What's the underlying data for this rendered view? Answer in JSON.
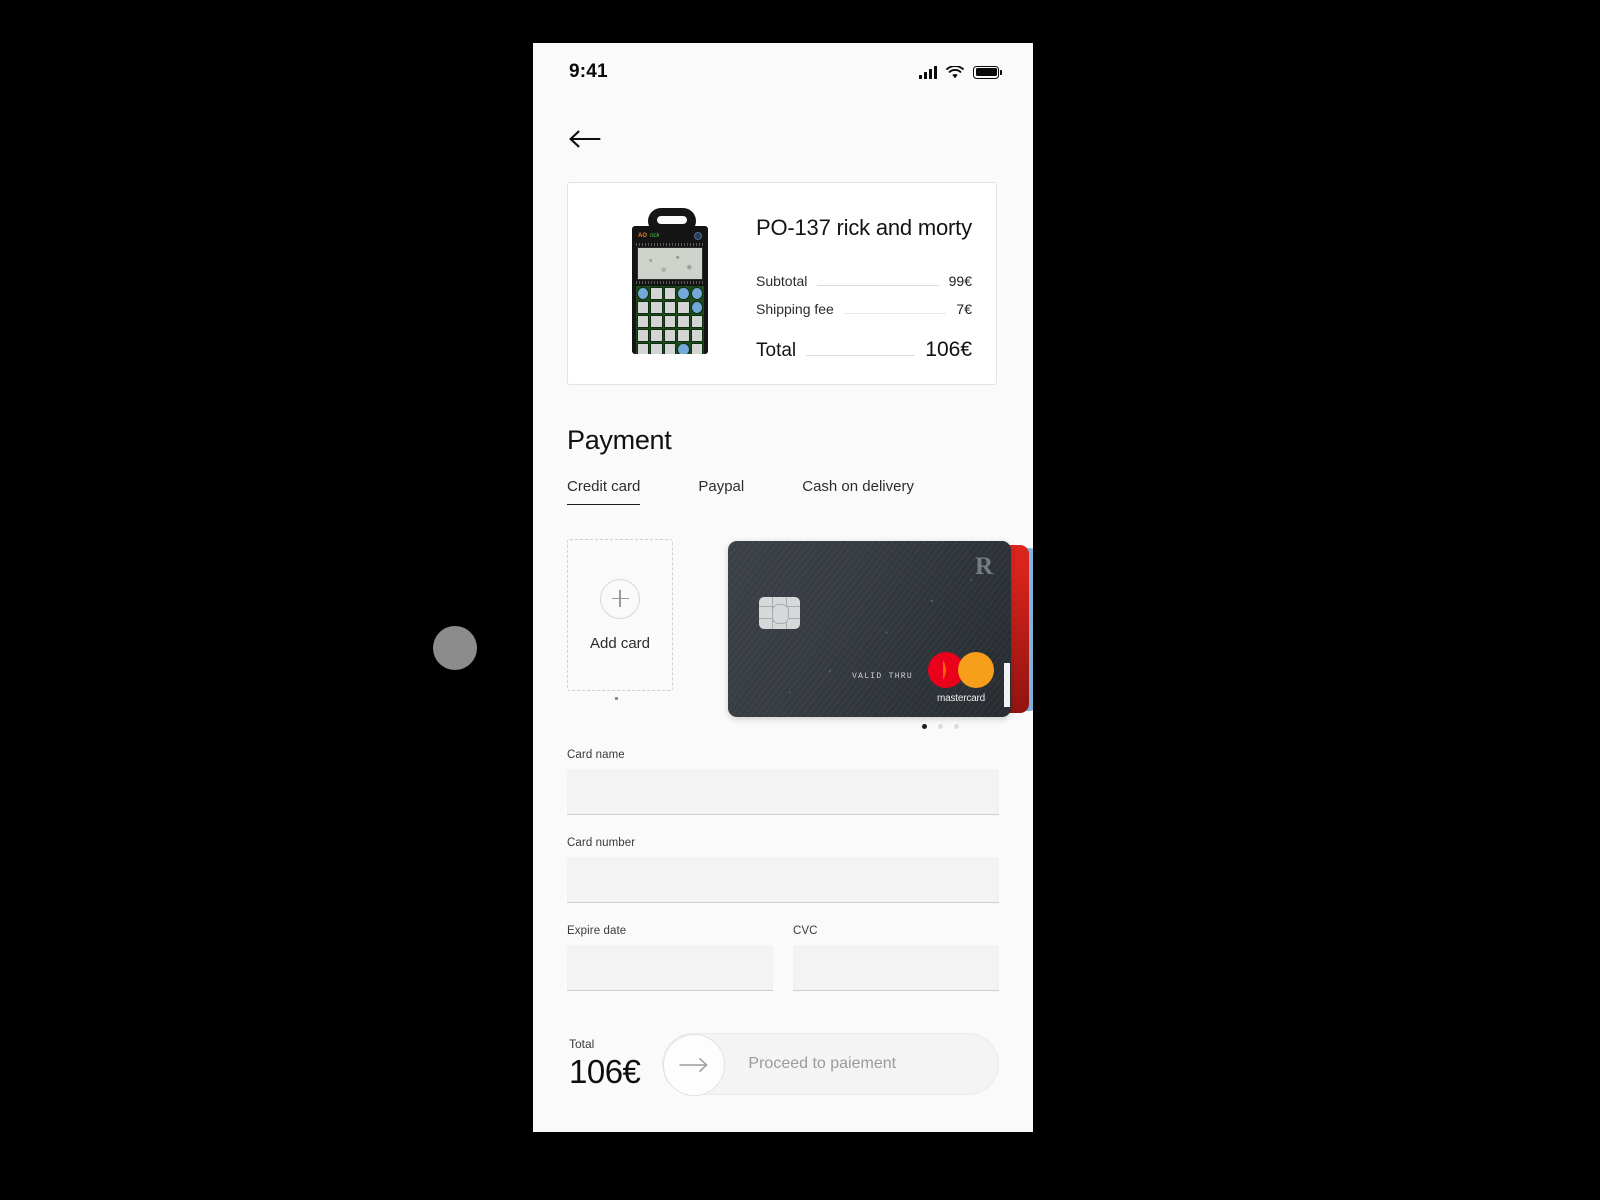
{
  "status_bar": {
    "time": "9:41",
    "signal_icon": "signal-bars-icon",
    "wifi_icon": "wifi-icon",
    "battery_icon": "battery-full-icon"
  },
  "nav": {
    "back_icon": "arrow-left-icon"
  },
  "order_summary": {
    "product_title": "PO-137 rick and morty",
    "product_image_alt": "pocket-operator-device",
    "rows": [
      {
        "label": "Subtotal",
        "value": "99€"
      },
      {
        "label": "Shipping fee",
        "value": "7€"
      }
    ],
    "total_label": "Total",
    "total_value": "106€"
  },
  "payment": {
    "heading": "Payment",
    "tabs": [
      {
        "label": "Credit card",
        "active": true
      },
      {
        "label": "Paypal",
        "active": false
      },
      {
        "label": "Cash on delivery",
        "active": false
      }
    ]
  },
  "cards": {
    "add_card_label": "Add card",
    "add_card_icon": "plus-circle-icon",
    "selected_card": {
      "brand_logo": "revolut-r-logo",
      "brand_letter": "R",
      "valid_thru_label": "VALID THRU",
      "network": "mastercard",
      "network_icon": "mastercard-logo",
      "background_color": "#33383d"
    },
    "stacked_card_colors": [
      "#e0241c",
      "#85b4dc"
    ],
    "pagination": {
      "count": 3,
      "active_index": 0
    }
  },
  "form": {
    "card_name": {
      "label": "Card name",
      "value": "",
      "placeholder": ""
    },
    "card_number": {
      "label": "Card number",
      "value": "",
      "placeholder": ""
    },
    "expire_date": {
      "label": "Expire date",
      "value": "",
      "placeholder": ""
    },
    "cvc": {
      "label": "CVC",
      "value": "",
      "placeholder": ""
    }
  },
  "footer": {
    "total_label": "Total",
    "total_value": "106€",
    "proceed_label": "Proceed to paiement",
    "proceed_icon": "arrow-right-icon"
  },
  "colors": {
    "background": "#000000",
    "screen": "#fafafa",
    "accent_dark": "#111111",
    "mastercard_red": "#EB001B",
    "mastercard_yellow": "#F79E1B",
    "mastercard_overlap": "#FF5F00"
  }
}
